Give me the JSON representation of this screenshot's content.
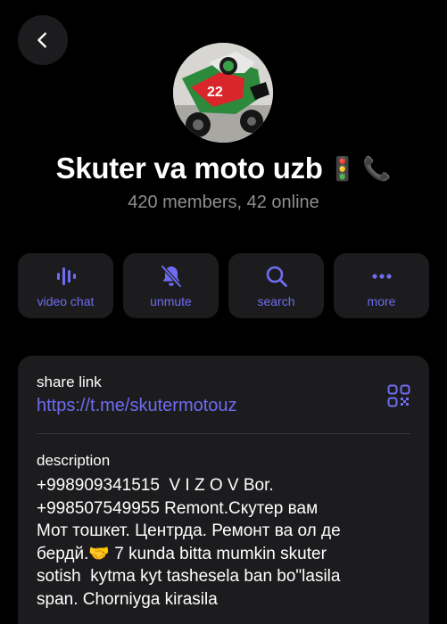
{
  "header": {
    "back_icon": "chevron-left-icon"
  },
  "group": {
    "name": "Skuter va moto uzb",
    "emoji_1": "🚦",
    "emoji_2": "📞",
    "subtitle": "420 members, 42 online"
  },
  "actions": [
    {
      "label": "video chat",
      "icon": "video-chat-icon"
    },
    {
      "label": "unmute",
      "icon": "bell-slash-icon"
    },
    {
      "label": "search",
      "icon": "search-icon"
    },
    {
      "label": "more",
      "icon": "more-icon"
    }
  ],
  "info": {
    "share_label": "share link",
    "share_url": "https://t.me/skutermotouz",
    "description_label": "description",
    "description": "+998909341515  V I Z O V Bor.\n+998507549955 Remont.Скутер вам\nМот тошкет. Центрда. Ремонт ва ол де\nбердй.🤝 7 kunda bitta mumkin skuter\nsotish  kytma kyt tashesela ban bo\"lasila\nspan. Chorniyga kirasila"
  },
  "colors": {
    "accent": "#6f6cf0",
    "background": "#000000",
    "card": "#1c1c1e",
    "secondary_text": "#8e8e93"
  }
}
